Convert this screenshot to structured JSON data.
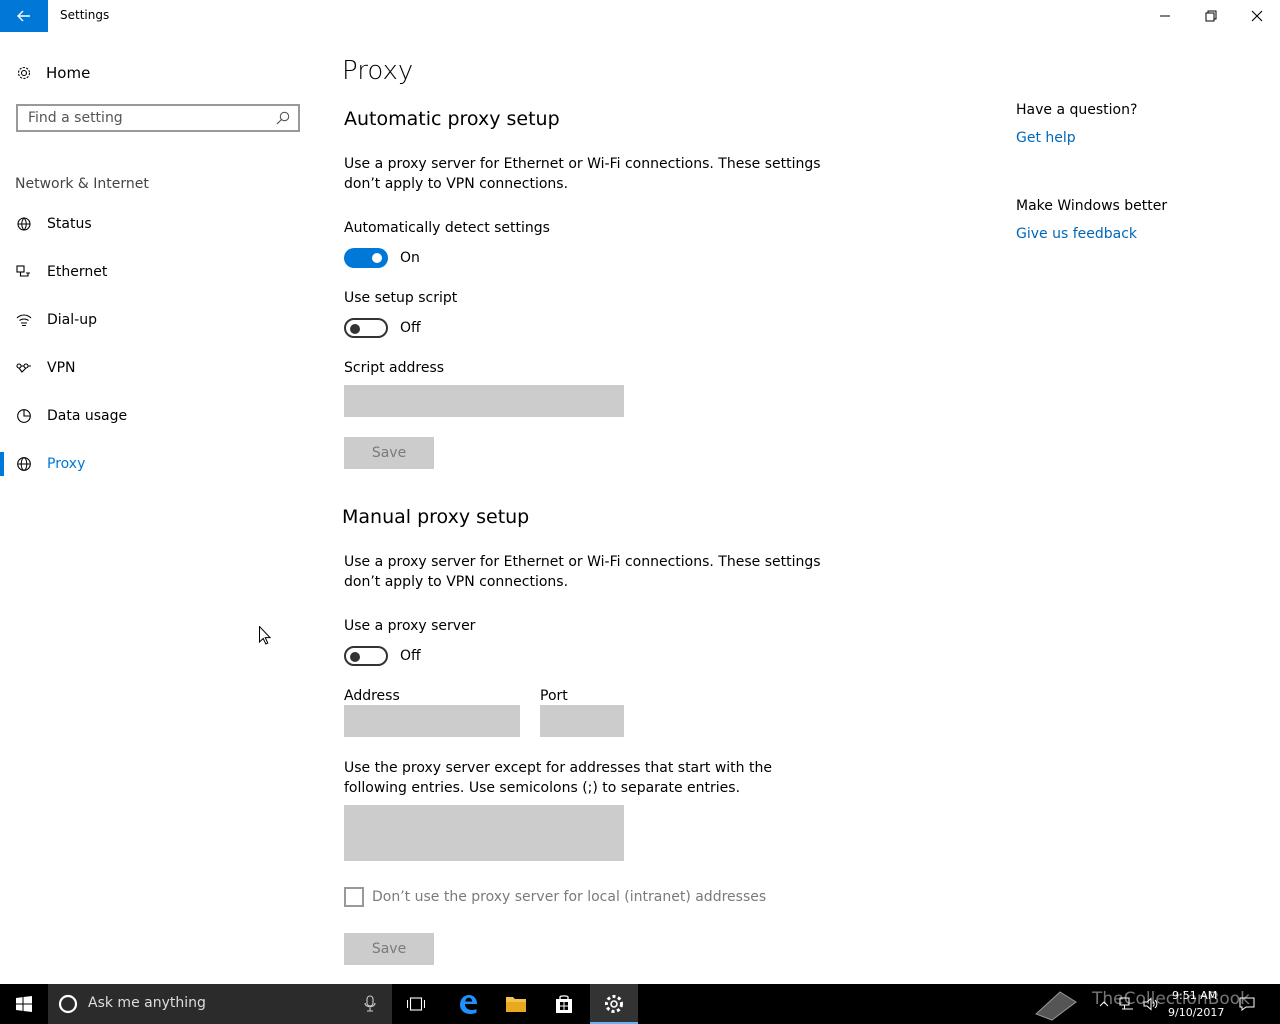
{
  "window": {
    "title": "Settings"
  },
  "sidebar": {
    "home_label": "Home",
    "search_placeholder": "Find a setting",
    "section_label": "Network & Internet",
    "items": [
      {
        "label": "Status",
        "icon": "status-icon"
      },
      {
        "label": "Ethernet",
        "icon": "ethernet-icon"
      },
      {
        "label": "Dial-up",
        "icon": "dialup-icon"
      },
      {
        "label": "VPN",
        "icon": "vpn-icon"
      },
      {
        "label": "Data usage",
        "icon": "data-usage-icon"
      },
      {
        "label": "Proxy",
        "icon": "globe-icon",
        "selected": true
      }
    ]
  },
  "main": {
    "title": "Proxy",
    "automatic": {
      "heading": "Automatic proxy setup",
      "description_line1": "Use a proxy server for Ethernet or Wi-Fi connections. These settings",
      "description_line2": "don’t apply to VPN connections.",
      "detect_label": "Automatically detect settings",
      "detect_state": "On",
      "script_label": "Use setup script",
      "script_state": "Off",
      "address_label": "Script address",
      "address_value": "",
      "save_label": "Save"
    },
    "manual": {
      "heading": "Manual proxy setup",
      "description_line1": "Use a proxy server for Ethernet or Wi-Fi connections. These settings",
      "description_line2": "don’t apply to VPN connections.",
      "use_proxy_label": "Use a proxy server",
      "use_proxy_state": "Off",
      "address_label": "Address",
      "port_label": "Port",
      "address_value": "",
      "port_value": "",
      "exceptions_line1": "Use the proxy server except for addresses that start with the",
      "exceptions_line2": "following entries. Use semicolons (;) to separate entries.",
      "exceptions_value": "",
      "local_checkbox_label": "Don’t use the proxy server for local (intranet) addresses",
      "save_label": "Save"
    }
  },
  "right_panel": {
    "question_heading": "Have a question?",
    "get_help": "Get help",
    "better_heading": "Make Windows better",
    "feedback": "Give us feedback"
  },
  "taskbar": {
    "search_placeholder": "Ask me anything",
    "time": "9:51 AM",
    "date": "9/10/2017",
    "watermark": "TheCollectionBook"
  },
  "colors": {
    "accent": "#0078d7",
    "link": "#0067b8",
    "disabled_field": "#cccccc"
  }
}
